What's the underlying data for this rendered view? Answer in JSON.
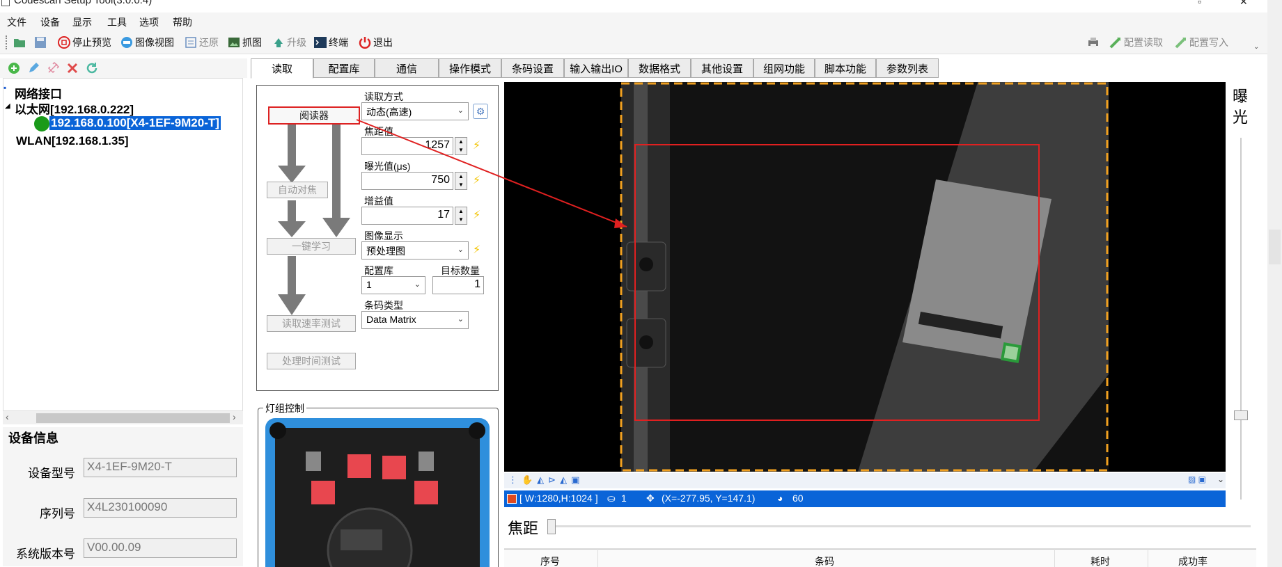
{
  "window": {
    "title": "Codescan Setup Tool(3.0.0.4)"
  },
  "menu": {
    "items": [
      "文件",
      "设备",
      "显示",
      "工具",
      "选项",
      "帮助"
    ]
  },
  "toolbar": {
    "stop_preview": "停止预览",
    "image_view": "图像视图",
    "restore": "还原",
    "capture": "抓图",
    "upgrade": "升级",
    "terminal": "终端",
    "exit": "退出",
    "config_read": "配置读取",
    "config_write": "配置写入"
  },
  "tree": {
    "root": "网络接口",
    "ethernet": "以太网[192.168.0.222]",
    "device": "192.168.0.100[X4-1EF-9M20-T]",
    "wlan": "WLAN[192.168.1.35]",
    "device_status_color": "#1a9a1a"
  },
  "device_info": {
    "title": "设备信息",
    "model_label": "设备型号",
    "model": "X4-1EF-9M20-T",
    "serial_label": "序列号",
    "serial": "X4L230100090",
    "version_label": "系统版本号",
    "version": "V00.00.09"
  },
  "tabs": [
    "读取",
    "配置库",
    "通信",
    "操作模式",
    "条码设置",
    "输入输出IO",
    "数据格式",
    "其他设置",
    "组网功能",
    "脚本功能",
    "参数列表"
  ],
  "read_panel": {
    "reader_button": "阅读器",
    "auto_focus_button": "自动对焦",
    "one_key_learn_button": "一键学习",
    "read_rate_test_button": "读取速率测试",
    "processing_time_test_button": "处理时间测试",
    "read_mode_label": "读取方式",
    "read_mode_value": "动态(高速)",
    "focus_label": "焦距值",
    "focus_value": "1257",
    "exposure_label": "曝光值(μs)",
    "exposure_value": "750",
    "gain_label": "增益值",
    "gain_value": "17",
    "image_display_label": "图像显示",
    "image_display_value": "预处理图",
    "config_lib_label": "配置库",
    "config_lib_value": "1",
    "target_count_label": "目标数量",
    "target_count_value": "1",
    "barcode_type_label": "条码类型",
    "barcode_type_value": "Data Matrix"
  },
  "light_group": {
    "title": "灯组控制"
  },
  "status": {
    "resolution": "[ W:1280,H:1024 ]",
    "count": "1",
    "coords": "(X=-277.95, Y=147.1)",
    "value": "60"
  },
  "exposure_panel": {
    "label": "曝光"
  },
  "focus_row": {
    "label": "焦距"
  },
  "result_table": {
    "columns": [
      "序号",
      "条码",
      "耗时",
      "成功率"
    ]
  }
}
